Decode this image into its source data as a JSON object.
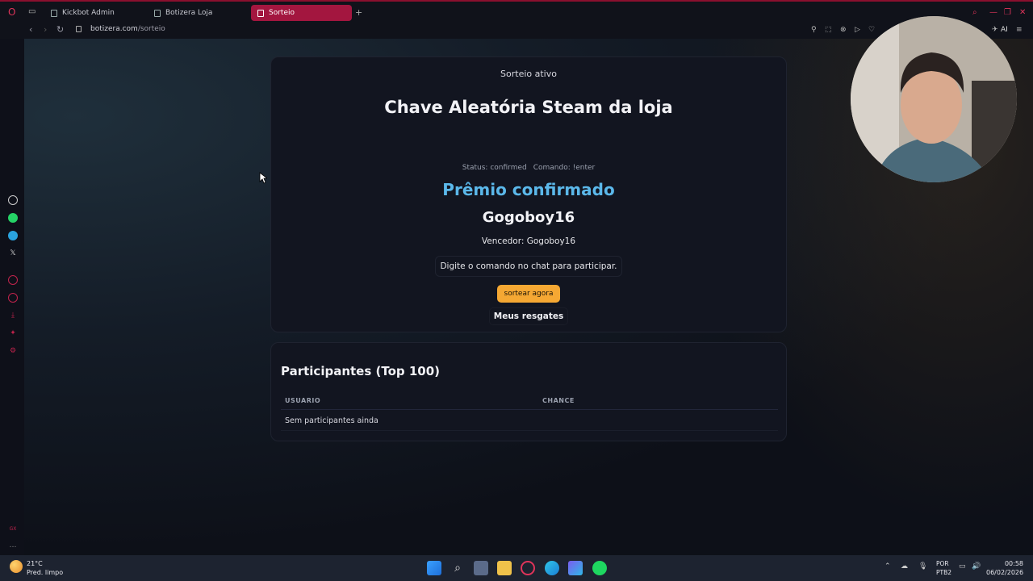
{
  "browser": {
    "tabs": [
      {
        "label": "Kickbot Admin",
        "active": false
      },
      {
        "label": "Botizera Loja",
        "active": false
      },
      {
        "label": "Sorteio",
        "active": true
      }
    ],
    "new_tab": "+",
    "url_domain": "botizera.com",
    "url_path": "/sorteio",
    "toolbar_ai_label": "AI",
    "accent_color": "#a3163f"
  },
  "sidebar": {
    "bottom_label": "GX"
  },
  "raffle": {
    "status_label": "Sorteio ativo",
    "title": "Chave Aleatória Steam da loja",
    "meta_status": "Status: confirmed",
    "meta_command": "Comando: !enter",
    "prize_status": "Prêmio confirmado",
    "winner_name": "Gogoboy16",
    "winner_line": "Vencedor: Gogoboy16",
    "hint": "Digite o comando no chat para participar.",
    "draw_button": "sortear agora",
    "redeem_button": "Meus resgates",
    "prize_color": "#5bb8ea",
    "draw_button_color": "#f5a833"
  },
  "participants": {
    "title": "Participantes (Top 100)",
    "columns": [
      "USUARIO",
      "CHANCE"
    ],
    "empty_text": "Sem participantes ainda"
  },
  "taskbar": {
    "temperature": "21°C",
    "condition": "Pred. limpo",
    "lang_top": "POR",
    "lang_bottom": "PTB2",
    "time": "00:58",
    "date": "06/02/2026"
  }
}
